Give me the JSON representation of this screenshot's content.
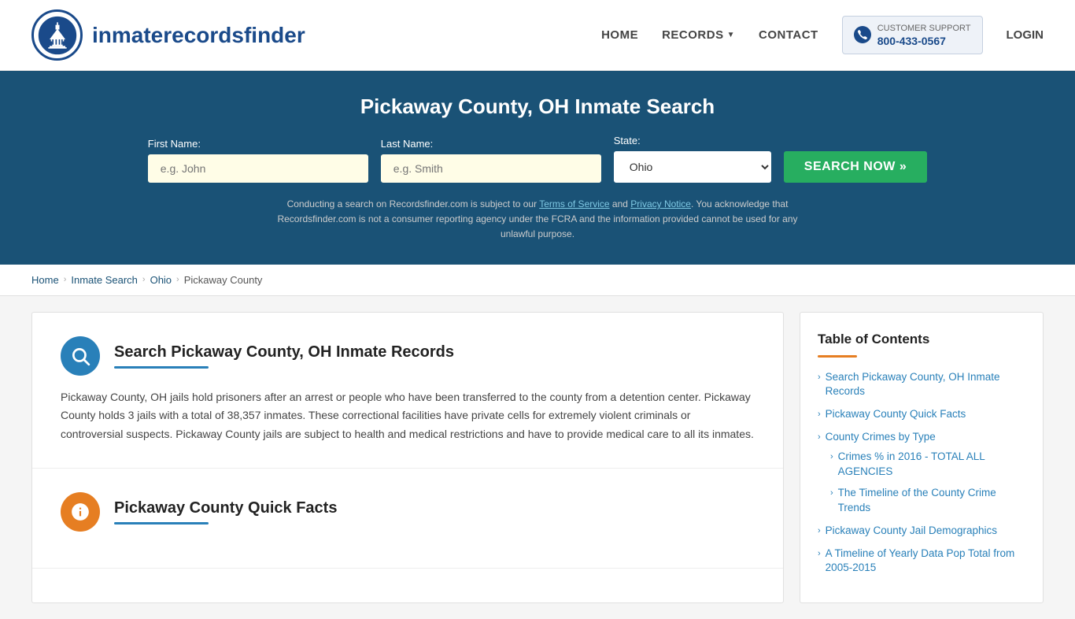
{
  "header": {
    "logo_text_regular": "inmaterecords",
    "logo_text_bold": "finder",
    "nav": {
      "home": "HOME",
      "records": "RECORDS",
      "contact": "CONTACT",
      "login": "LOGIN"
    },
    "support": {
      "label": "CUSTOMER SUPPORT",
      "phone": "800-433-0567"
    }
  },
  "hero": {
    "title": "Pickaway County, OH Inmate Search",
    "form": {
      "first_name_label": "First Name:",
      "first_name_placeholder": "e.g. John",
      "last_name_label": "Last Name:",
      "last_name_placeholder": "e.g. Smith",
      "state_label": "State:",
      "state_value": "Ohio",
      "search_button": "SEARCH NOW »"
    },
    "disclaimer": "Conducting a search on Recordsfinder.com is subject to our Terms of Service and Privacy Notice. You acknowledge that Recordsfinder.com is not a consumer reporting agency under the FCRA and the information provided cannot be used for any unlawful purpose."
  },
  "breadcrumb": {
    "items": [
      "Home",
      "Inmate Search",
      "Ohio",
      "Pickaway County"
    ]
  },
  "article": {
    "sections": [
      {
        "id": "inmate-records",
        "icon": "search",
        "icon_color": "blue",
        "title": "Search Pickaway County, OH Inmate Records",
        "body": "Pickaway County, OH jails hold prisoners after an arrest or people who have been transferred to the county from a detention center. Pickaway County holds 3 jails with a total of 38,357 inmates. These correctional facilities have private cells for extremely violent criminals or controversial suspects. Pickaway County jails are subject to health and medical restrictions and have to provide medical care to all its inmates."
      },
      {
        "id": "quick-facts",
        "icon": "info",
        "icon_color": "orange",
        "title": "Pickaway County Quick Facts",
        "body": ""
      }
    ]
  },
  "sidebar": {
    "toc": {
      "title": "Table of Contents",
      "items": [
        {
          "label": "Search Pickaway County, OH Inmate Records",
          "sub": []
        },
        {
          "label": "Pickaway County Quick Facts",
          "sub": []
        },
        {
          "label": "County Crimes by Type",
          "sub": [
            {
              "label": "Crimes % in 2016 - TOTAL ALL AGENCIES"
            },
            {
              "label": "The Timeline of the County Crime Trends"
            }
          ]
        },
        {
          "label": "Pickaway County Jail Demographics",
          "sub": []
        },
        {
          "label": "A Timeline of Yearly Data Pop Total from 2005-2015",
          "sub": []
        }
      ]
    }
  }
}
